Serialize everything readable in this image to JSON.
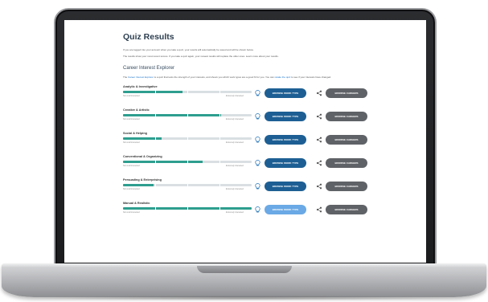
{
  "page": {
    "title": "Quiz Results",
    "intro_1": "If you are logged into your account when you take a quiz, your results will automatically be saved and will be shown below.",
    "intro_2": "The results show your most recent scores. If you take a quiz again, your newest results will replace the older ones. Learn more about your results."
  },
  "explorer": {
    "section_title": "Career Interest Explorer",
    "desc_pre": "The",
    "desc_link": "Career Interest Explorer",
    "desc_mid": "is a quiz that tests the strength of your interests, and shows you which work types are a good fit for you. You can",
    "desc_link2": "retake the quiz",
    "desc_post": "to see if your interests have changed.",
    "scale_low": "Not at all interested",
    "scale_high": "Extremely interested",
    "rows": [
      {
        "label": "Analytic & Investigative",
        "fill_pct": 46,
        "primary": "BROWSE WORK TYPE",
        "secondary": "BROWSE CAREERS",
        "light": false
      },
      {
        "label": "Creative & Artistic",
        "fill_pct": 76,
        "primary": "BROWSE WORK TYPE",
        "secondary": "BROWSE CAREERS",
        "light": false
      },
      {
        "label": "Social & Helping",
        "fill_pct": 30,
        "primary": "BROWSE WORK TYPE",
        "secondary": "BROWSE CAREERS",
        "light": false
      },
      {
        "label": "Conventional & Organizing",
        "fill_pct": 62,
        "primary": "BROWSE WORK TYPE",
        "secondary": "BROWSE CAREERS",
        "light": false
      },
      {
        "label": "Persuading & Enterprising",
        "fill_pct": 24,
        "primary": "BROWSE WORK TYPE",
        "secondary": "BROWSE CAREERS",
        "light": false
      },
      {
        "label": "Manual & Realistic",
        "fill_pct": 100,
        "primary": "BROWSE WORK TYPE",
        "secondary": "BROWSE CAREERS",
        "light": true
      }
    ]
  },
  "colors": {
    "fill": "#2e9e8f",
    "primary_button": "#1d5f94",
    "primary_button_light": "#6aa9e5",
    "secondary_button": "#5f6266"
  },
  "icons": {
    "bulb": "lightbulb-icon",
    "share": "share-icon"
  }
}
